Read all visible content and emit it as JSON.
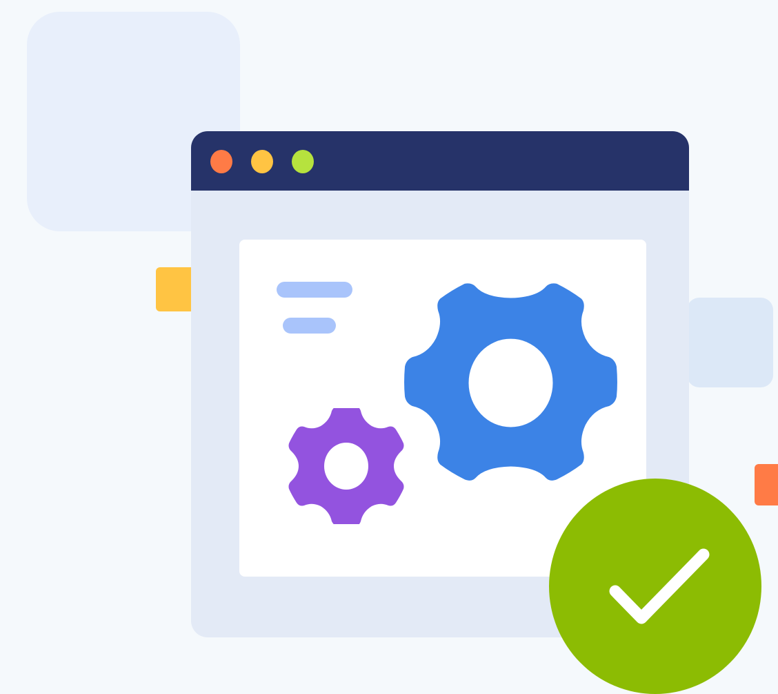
{
  "illustration": {
    "window": {
      "titlebar_color": "#263369",
      "body_color": "#e3eaf6",
      "panel_color": "#ffffff",
      "window_controls": [
        {
          "name": "close-dot-icon",
          "color": "#ff7b46"
        },
        {
          "name": "minimize-dot-icon",
          "color": "#ffc443"
        },
        {
          "name": "maximize-dot-icon",
          "color": "#b6e23e"
        }
      ],
      "placeholder_text_lines": 2,
      "placeholder_line_color": "#a9c4fb"
    },
    "icons": [
      {
        "name": "large-gear-icon",
        "color": "#3c83e6"
      },
      {
        "name": "small-gear-icon",
        "color": "#9353df"
      },
      {
        "name": "checkmark-badge-icon",
        "color": "#8cbc03",
        "mark_color": "#ffffff"
      }
    ],
    "decorations": {
      "large_square_color": "#e8effb",
      "right_square_color": "#dce8f7",
      "yellow_tab_color": "#ffc443",
      "orange_tab_color": "#ff7b46"
    },
    "background_color": "#f5f9fc"
  }
}
